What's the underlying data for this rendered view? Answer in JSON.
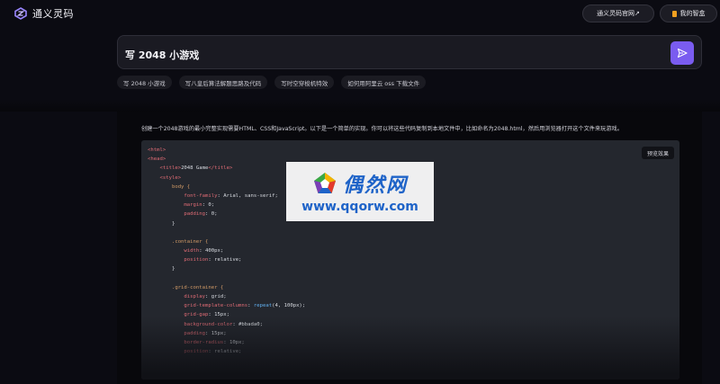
{
  "header": {
    "app_name": "通义灵码",
    "official_button": "通义灵码官网↗",
    "library_button": "我的智盒"
  },
  "prompt": {
    "text": "写 2048 小游戏"
  },
  "suggestions": [
    "写 2048 小游戏",
    "写八皇后算法解题思路及代码",
    "写时空穿梭机特效",
    "如何用阿里云 oss 下载文件"
  ],
  "answer": {
    "intro": "创建一个2048游戏的最小完整实现需要HTML、CSS和JavaScript。以下是一个简单的实现。你可以将这些代码复制到本地文件中，比如命名为2048.html，然后用浏览器打开这个文件来玩游戏。",
    "preview_button": "预览效果",
    "code_lines": [
      "<html>",
      "<head>",
      "    <title>2048 Game</title>",
      "    <style>",
      "        body {",
      "            font-family: Arial, sans-serif;",
      "            margin: 0;",
      "            padding: 0;",
      "        }",
      "",
      "        .container {",
      "            width: 400px;",
      "            position: relative;",
      "        }",
      "",
      "        .grid-container {",
      "            display: grid;",
      "            grid-template-columns: repeat(4, 100px);",
      "            grid-gap: 15px;",
      "            background-color: #bbada0;",
      "            padding: 15px;",
      "            border-radius: 10px;",
      "            position: relative;"
    ]
  },
  "watermark": {
    "name": "偶然网",
    "url": "www.qqorw.com"
  },
  "colors": {
    "accent": "#7a5cf0",
    "background": "#0b0b12",
    "code_bg": "#24272e"
  }
}
